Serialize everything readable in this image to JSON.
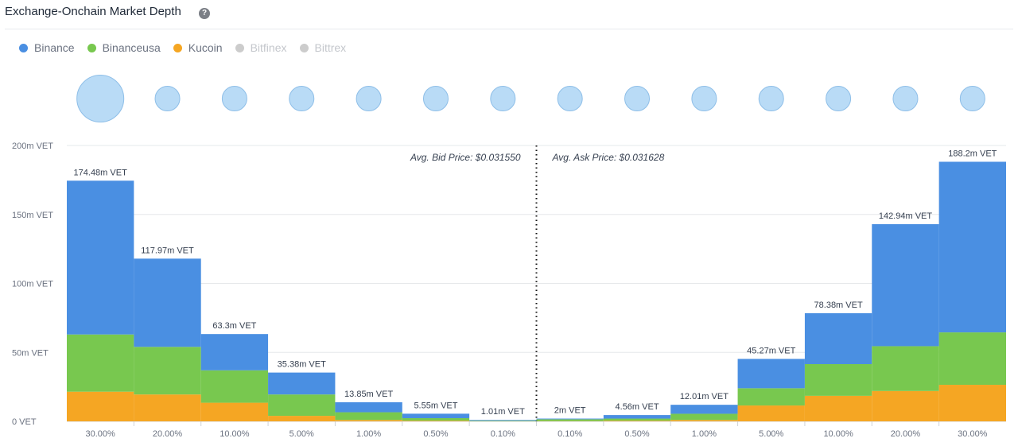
{
  "header": {
    "title": "Exchange-Onchain Market Depth",
    "help_icon": "question-circle-icon"
  },
  "legend": [
    {
      "label": "Binance",
      "color": "#4a8fe2",
      "active": true
    },
    {
      "label": "Binanceusa",
      "color": "#78c84f",
      "active": true
    },
    {
      "label": "Kucoin",
      "color": "#f5a623",
      "active": true
    },
    {
      "label": "Bitfinex",
      "color": "#cccccc",
      "active": false
    },
    {
      "label": "Bittrex",
      "color": "#cccccc",
      "active": false
    }
  ],
  "chart_data": {
    "type": "bar",
    "stacked": true,
    "categories": [
      "30.00%",
      "20.00%",
      "10.00%",
      "5.00%",
      "1.00%",
      "0.50%",
      "0.10%",
      "0.10%",
      "0.50%",
      "1.00%",
      "5.00%",
      "10.00%",
      "20.00%",
      "30.00%"
    ],
    "series": [
      {
        "name": "Kucoin",
        "color": "#f5a623",
        "values": [
          21.5,
          19.5,
          13.5,
          4,
          1,
          0.5,
          0.1,
          0.2,
          0.5,
          1,
          11.5,
          18.5,
          22,
          26.5
        ]
      },
      {
        "name": "Binanceusa",
        "color": "#78c84f",
        "values": [
          41.5,
          34.5,
          23.5,
          15.5,
          5.6,
          1.8,
          0.4,
          1.3,
          1.5,
          4.5,
          12.5,
          23,
          32.5,
          38
        ]
      },
      {
        "name": "Binance",
        "color": "#4a8fe2",
        "values": [
          111.48,
          63.97,
          26.3,
          15.88,
          7.25,
          3.25,
          0.51,
          0.5,
          2.56,
          6.51,
          21.27,
          36.88,
          88.44,
          123.7
        ]
      }
    ],
    "totals": [
      174.48,
      117.97,
      63.3,
      35.38,
      13.85,
      5.55,
      1.01,
      2,
      4.56,
      12.01,
      45.27,
      78.38,
      142.94,
      188.2
    ],
    "total_labels": [
      "174.48m VET",
      "117.97m VET",
      "63.3m VET",
      "35.38m VET",
      "13.85m VET",
      "5.55m VET",
      "1.01m VET",
      "2m VET",
      "4.56m VET",
      "12.01m VET",
      "45.27m VET",
      "78.38m VET",
      "142.94m VET",
      "188.2m VET"
    ],
    "bubble_sizes": [
      174.48,
      117.97,
      63.3,
      35.38,
      13.85,
      5.55,
      1.01,
      2,
      4.56,
      12.01,
      45.27,
      78.38,
      142.94,
      188.2
    ],
    "ylim": [
      0,
      200
    ],
    "yticks": [
      0,
      50,
      100,
      150,
      200
    ],
    "ytick_labels": [
      "0 VET",
      "50m VET",
      "100m VET",
      "150m VET",
      "200m VET"
    ],
    "grid": true,
    "annotations": {
      "bid": "Avg. Bid Price: $0.031550",
      "ask": "Avg. Ask Price: $0.031628"
    }
  }
}
